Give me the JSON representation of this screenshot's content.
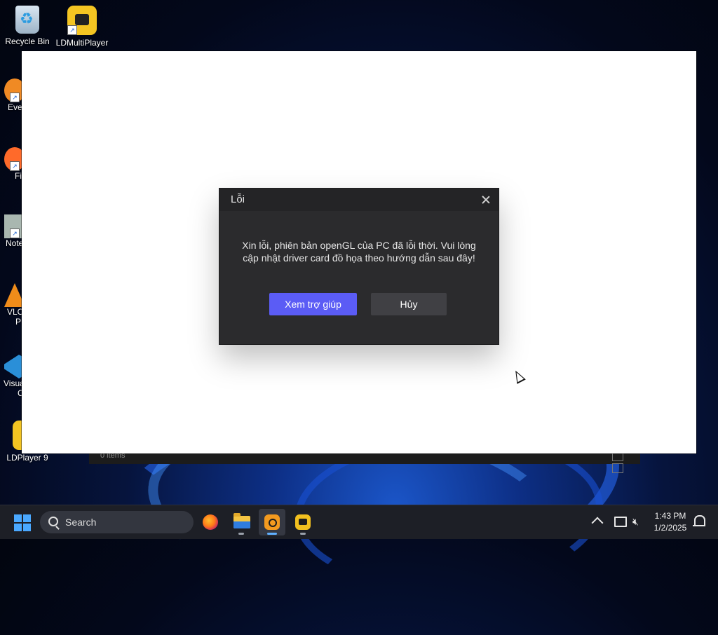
{
  "desktop": {
    "icons": [
      {
        "label": "Recycle Bin",
        "icon": "recycle-bin-icon"
      },
      {
        "label": "LDMultiPlayer",
        "icon": "ldmultiplayer-icon"
      }
    ],
    "partial_icons": [
      {
        "label": "Eve",
        "icon": "everything-icon"
      },
      {
        "label": "Fi",
        "icon": "firefox-icon"
      },
      {
        "label": "Note",
        "icon": "notepad-icon"
      },
      {
        "label": "VLC",
        "icon": "vlc-icon"
      },
      {
        "label": "P",
        "icon": "vlc-icon"
      },
      {
        "label": "Visua",
        "icon": "visual-studio-code-icon"
      },
      {
        "label": "C",
        "icon": "visual-studio-code-icon"
      },
      {
        "label": "LDPlayer 9",
        "icon": "ldplayer-icon"
      }
    ],
    "behind_window": {
      "status": "0 items"
    }
  },
  "dialog": {
    "title": "Lỗi",
    "message": "Xin lỗi, phiên bản openGL của PC đã lỗi thời. Vui lòng cập nhật driver card đồ họa theo hướng dẫn sau đây!",
    "help_button": "Xem trợ giúp",
    "cancel_button": "Hủy",
    "accent_color": "#5b5cf5"
  },
  "taskbar": {
    "search_placeholder": "Search",
    "apps": [
      {
        "name": "firefox",
        "icon": "firefox-icon"
      },
      {
        "name": "file-explorer",
        "icon": "folder-icon"
      },
      {
        "name": "ldplayer",
        "icon": "ldplayer-icon",
        "active": true
      },
      {
        "name": "ldmultiplayer",
        "icon": "ldmultiplayer-icon"
      }
    ],
    "time": "1:43 PM",
    "date": "1/2/2025"
  }
}
